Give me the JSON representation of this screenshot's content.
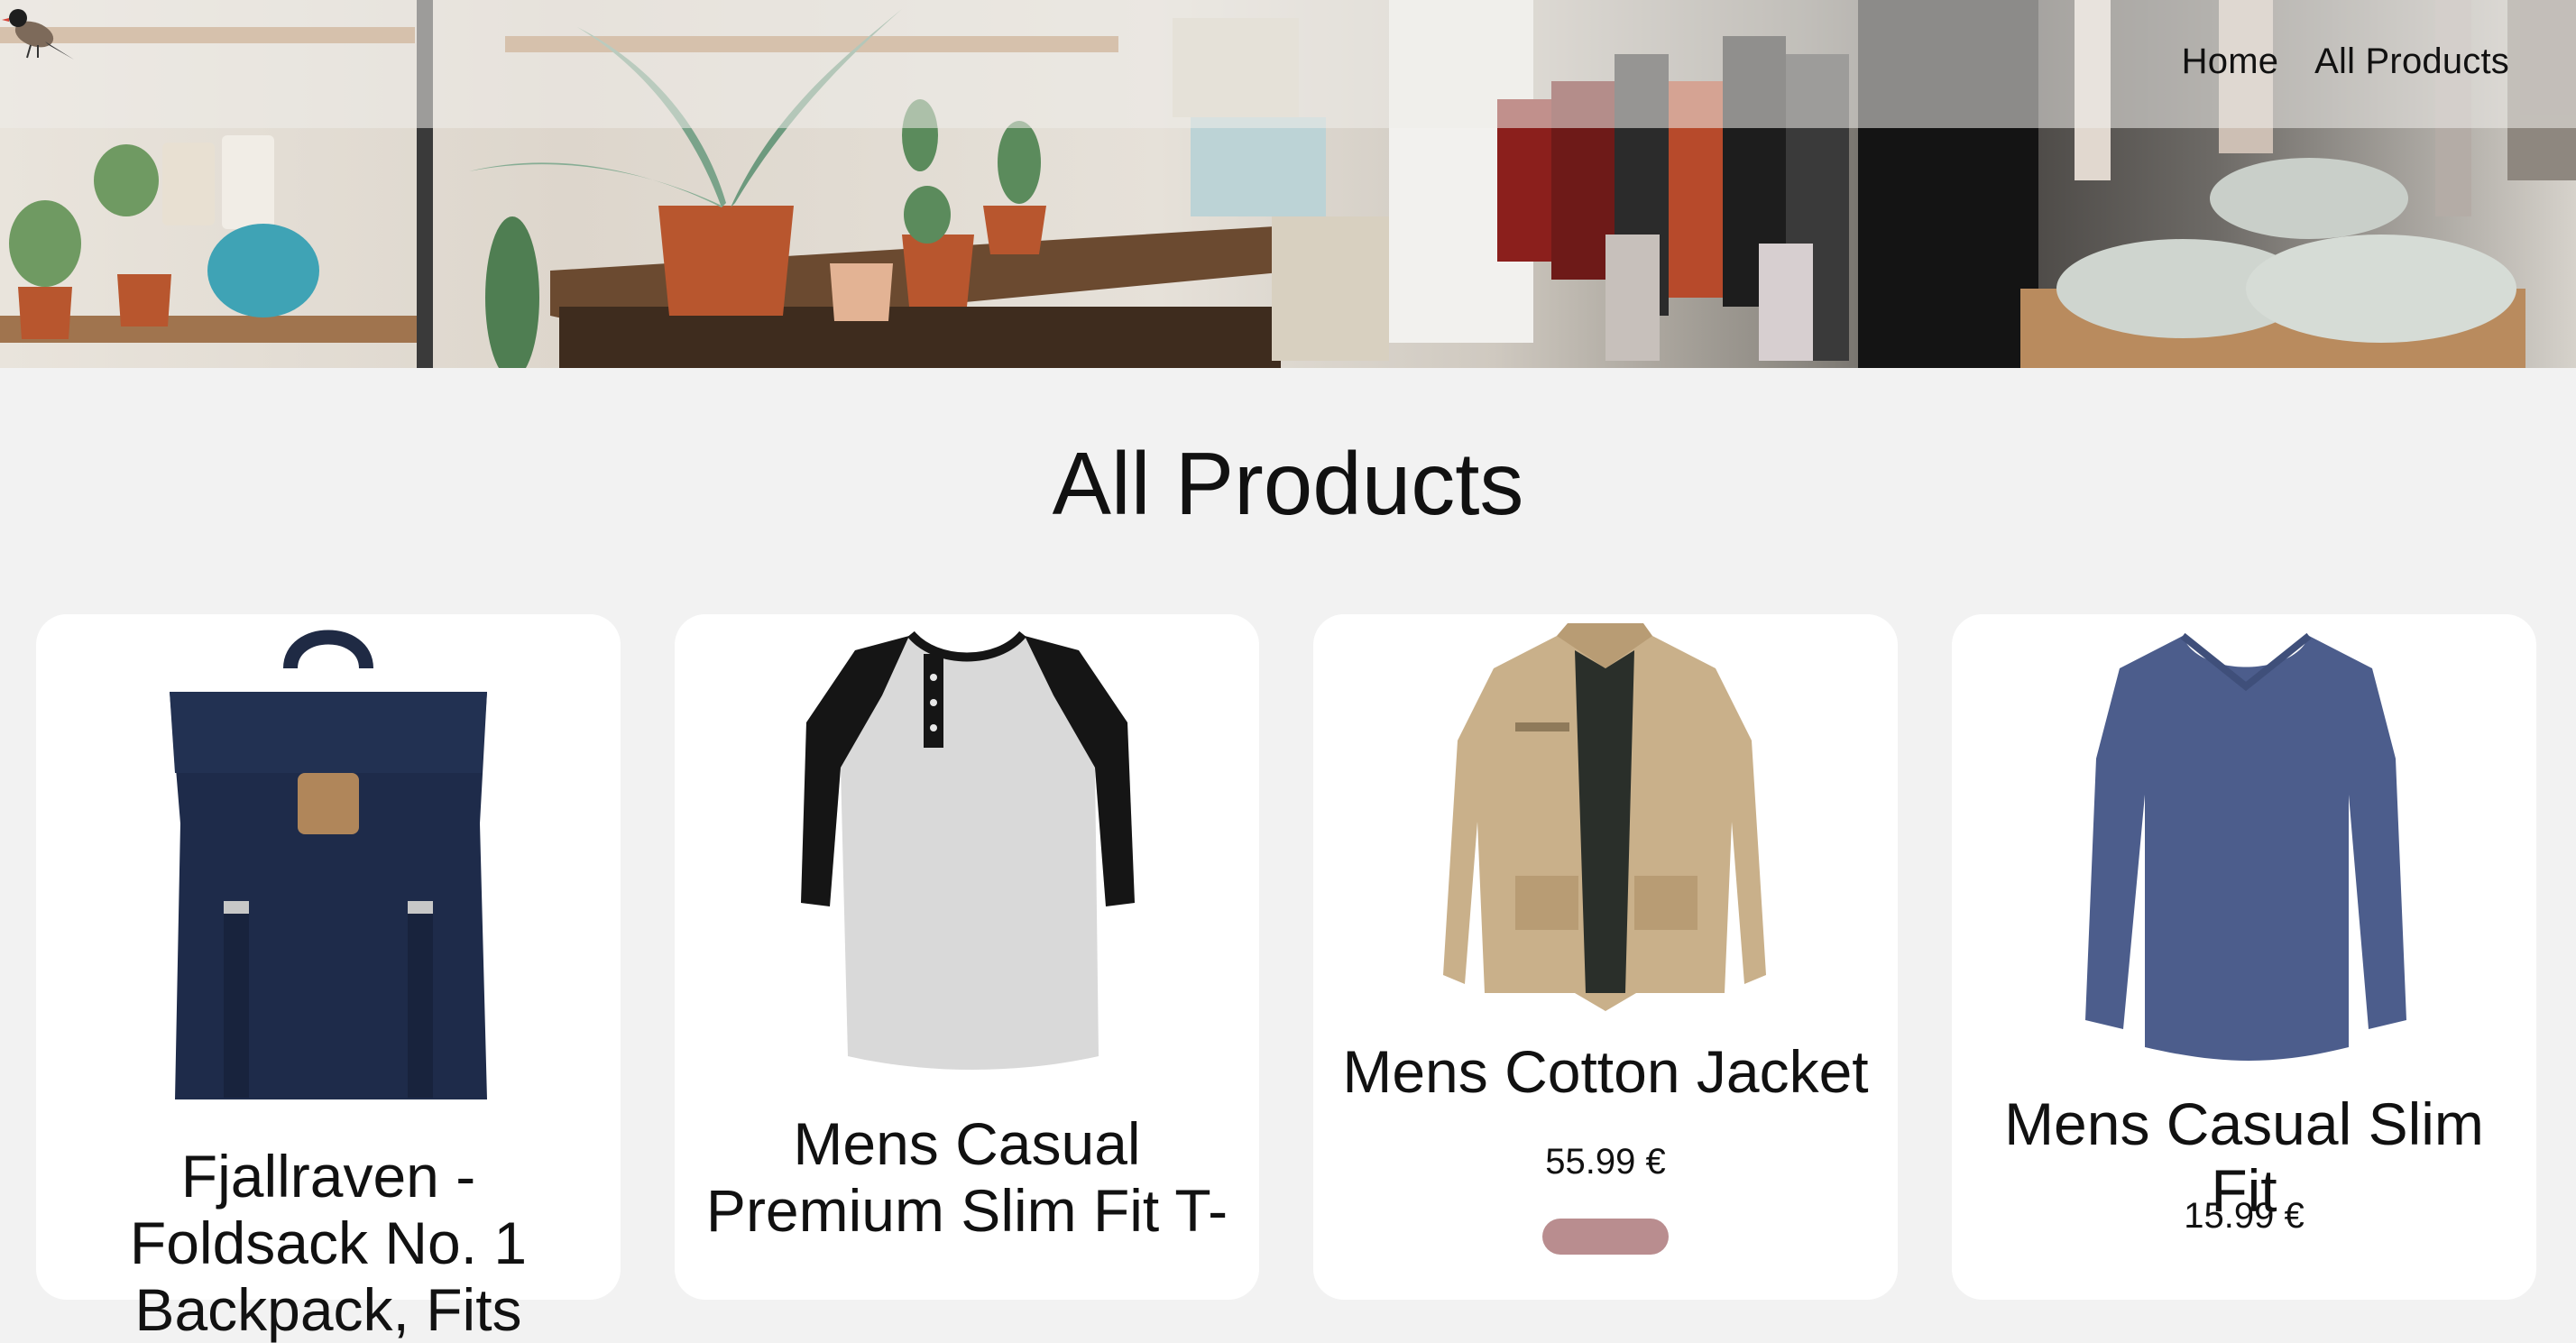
{
  "nav": {
    "logo_icon": "bird-logo-icon",
    "links": [
      {
        "label": "Home"
      },
      {
        "label": "All Products"
      }
    ]
  },
  "main": {
    "title": "All Products"
  },
  "products": [
    {
      "name": "Fjallraven - Foldsack No. 1 Backpack, Fits",
      "price": "",
      "icon": "backpack-image"
    },
    {
      "name": "Mens Casual Premium Slim Fit T-",
      "price": "",
      "icon": "tshirt-image"
    },
    {
      "name": "Mens Cotton Jacket",
      "price": "55.99 €",
      "icon": "jacket-image"
    },
    {
      "name": "Mens Casual Slim Fit",
      "price": "15.99 €",
      "icon": "longsleeve-image"
    }
  ],
  "colors": {
    "page_bg": "#f2f2f2",
    "card_bg": "#ffffff",
    "button": "#b98d8f"
  }
}
